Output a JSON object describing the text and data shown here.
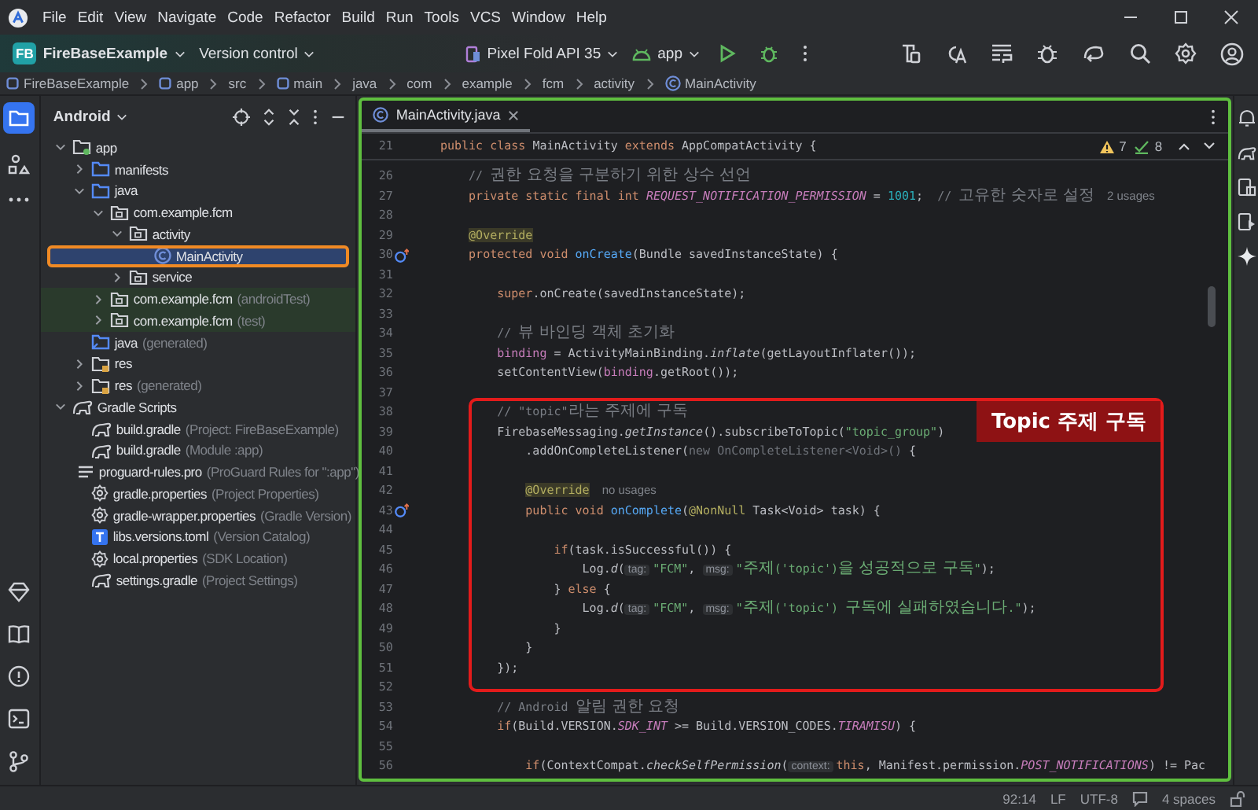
{
  "menu": [
    "File",
    "Edit",
    "View",
    "Navigate",
    "Code",
    "Refactor",
    "Build",
    "Run",
    "Tools",
    "VCS",
    "Window",
    "Help"
  ],
  "toolbar": {
    "project_badge": "FB",
    "project": "FireBaseExample",
    "vcs": "Version control",
    "device": "Pixel Fold API 35",
    "run_config": "app"
  },
  "breadcrumbs": [
    {
      "label": "FireBaseExample",
      "kind": "module"
    },
    {
      "label": "app",
      "kind": "module"
    },
    {
      "label": "src",
      "kind": "dir"
    },
    {
      "label": "main",
      "kind": "module"
    },
    {
      "label": "java",
      "kind": "dir"
    },
    {
      "label": "com",
      "kind": "dir"
    },
    {
      "label": "example",
      "kind": "dir"
    },
    {
      "label": "fcm",
      "kind": "dir"
    },
    {
      "label": "activity",
      "kind": "dir"
    },
    {
      "label": "MainActivity",
      "kind": "class"
    }
  ],
  "project": {
    "view": "Android",
    "tree": [
      {
        "label": "app",
        "kind": "module",
        "expanded": true,
        "selected": false,
        "children": [
          {
            "label": "manifests",
            "kind": "src_folder",
            "expanded": false,
            "selected": false
          },
          {
            "label": "java",
            "kind": "src_folder",
            "expanded": true,
            "selected": false,
            "children": [
              {
                "label": "com.example.fcm",
                "kind": "package",
                "expanded": true,
                "selected": false,
                "children": [
                  {
                    "label": "activity",
                    "kind": "package",
                    "expanded": true,
                    "selected": false,
                    "children": [
                      {
                        "label": "MainActivity",
                        "kind": "class",
                        "selected": true,
                        "highlighted": true
                      }
                    ]
                  },
                  {
                    "label": "service",
                    "kind": "package",
                    "expanded": false,
                    "selected": false
                  }
                ]
              },
              {
                "label": "com.example.fcm",
                "hint": "(androidTest)",
                "kind": "test_package",
                "expanded": false,
                "selected": false
              },
              {
                "label": "com.example.fcm",
                "hint": "(test)",
                "kind": "test_package",
                "expanded": false,
                "selected": false
              }
            ]
          },
          {
            "label": "java",
            "hint": "(generated)",
            "kind": "gen_folder",
            "selected": false
          },
          {
            "label": "res",
            "kind": "res_folder",
            "expanded": false,
            "selected": false
          },
          {
            "label": "res",
            "hint": "(generated)",
            "kind": "res_folder",
            "expanded": false,
            "selected": false
          }
        ]
      },
      {
        "label": "Gradle Scripts",
        "kind": "gradle",
        "expanded": true,
        "selected": false,
        "children": [
          {
            "label": "build.gradle",
            "hint": "(Project: FireBaseExample)",
            "kind": "gradle",
            "selected": false
          },
          {
            "label": "build.gradle",
            "hint": "(Module :app)",
            "kind": "gradle",
            "selected": false
          },
          {
            "label": "proguard-rules.pro",
            "hint": "(ProGuard Rules for \":app\")",
            "kind": "proguard",
            "selected": false
          },
          {
            "label": "gradle.properties",
            "hint": "(Project Properties)",
            "kind": "properties",
            "selected": false
          },
          {
            "label": "gradle-wrapper.properties",
            "hint": "(Gradle Version)",
            "kind": "properties",
            "selected": false
          },
          {
            "label": "libs.versions.toml",
            "hint": "(Version Catalog)",
            "kind": "toml",
            "selected": false
          },
          {
            "label": "local.properties",
            "hint": "(SDK Location)",
            "kind": "properties",
            "selected": false
          },
          {
            "label": "settings.gradle",
            "hint": "(Project Settings)",
            "kind": "gradle",
            "selected": false
          }
        ]
      }
    ]
  },
  "editor": {
    "tab": "MainActivity.java",
    "warnings": "7",
    "checks": "8",
    "sticky": {
      "number": "21",
      "tokens": [
        {
          "kind": "kw",
          "text": "    public class "
        },
        {
          "kind": "txt",
          "text": "MainActivity "
        },
        {
          "kind": "kw",
          "text": "extends "
        },
        {
          "kind": "txt",
          "text": "AppCompatActivity {"
        }
      ]
    },
    "lines_before": [
      {
        "number": "26",
        "tokens": [
          {
            "kind": "com",
            "text": "        // "
          },
          {
            "kind": "com_ko",
            "text": "권한 요청을 구분하기 위한 상수 선언"
          }
        ]
      },
      {
        "number": "27",
        "tokens": [
          {
            "kind": "kw",
            "text": "        private static final int "
          },
          {
            "kind": "sfield",
            "text": "REQUEST_NOTIFICATION_PERMISSION"
          },
          {
            "kind": "txt",
            "text": " = "
          },
          {
            "kind": "num",
            "text": "1001"
          },
          {
            "kind": "txt",
            "text": ";  "
          },
          {
            "kind": "com",
            "text": "// "
          },
          {
            "kind": "com_ko",
            "text": "고유한 숫자로 설정"
          },
          {
            "kind": "hint",
            "text": "2 usages"
          }
        ]
      },
      {
        "number": "28"
      },
      {
        "number": "29",
        "tokens": [
          {
            "kind": "ann_marked",
            "text": "        @Override"
          }
        ]
      },
      {
        "number": "30",
        "override_marker": true,
        "tokens": [
          {
            "kind": "kw",
            "text": "        protected void "
          },
          {
            "kind": "decl",
            "text": "onCreate"
          },
          {
            "kind": "txt",
            "text": "(Bundle savedInstanceState) {"
          }
        ]
      },
      {
        "number": "31"
      },
      {
        "number": "32",
        "tokens": [
          {
            "kind": "kw",
            "text": "            super"
          },
          {
            "kind": "txt",
            "text": ".onCreate(savedInstanceState);"
          }
        ]
      },
      {
        "number": "33"
      },
      {
        "number": "34",
        "tokens": [
          {
            "kind": "com",
            "text": "            // "
          },
          {
            "kind": "com_ko",
            "text": "뷰 바인딩 객체 초기화"
          }
        ]
      },
      {
        "number": "35",
        "tokens": [
          {
            "kind": "field",
            "text": "            binding"
          },
          {
            "kind": "txt",
            "text": " = ActivityMainBinding."
          },
          {
            "kind": "ital",
            "text": "inflate"
          },
          {
            "kind": "txt",
            "text": "(getLayoutInflater());"
          }
        ]
      },
      {
        "number": "36",
        "tokens": [
          {
            "kind": "txt",
            "text": "            setContentView("
          },
          {
            "kind": "field",
            "text": "binding"
          },
          {
            "kind": "txt",
            "text": ".getRoot());"
          }
        ]
      },
      {
        "number": "37"
      }
    ],
    "callout": {
      "label": "Topic 주제 구독",
      "lines": [
        {
          "number": "38",
          "tokens": [
            {
              "kind": "com",
              "text": "            // \"topic\""
            },
            {
              "kind": "com_ko",
              "text": "라는 주제에 구독"
            }
          ]
        },
        {
          "number": "39",
          "tokens": [
            {
              "kind": "txt",
              "text": "            FirebaseMessaging."
            },
            {
              "kind": "ital",
              "text": "getInstance"
            },
            {
              "kind": "txt",
              "text": "().subscribeToTopic("
            },
            {
              "kind": "str",
              "text": "\"topic_group\""
            },
            {
              "kind": "txt",
              "text": ")"
            }
          ]
        },
        {
          "number": "40",
          "tokens": [
            {
              "kind": "txt",
              "text": "                .addOnCompleteListener("
            },
            {
              "kind": "dim",
              "text": "new OnCompleteListener<Void>()"
            },
            {
              "kind": "txt",
              "text": " {"
            }
          ]
        },
        {
          "number": "41"
        },
        {
          "number": "42",
          "tokens": [
            {
              "kind": "ann_marked",
              "text": "                @Override"
            },
            {
              "kind": "hint",
              "text": "no usages"
            }
          ]
        },
        {
          "number": "43",
          "override_marker": true,
          "tokens": [
            {
              "kind": "kw",
              "text": "                public void "
            },
            {
              "kind": "decl",
              "text": "onComplete"
            },
            {
              "kind": "txt",
              "text": "("
            },
            {
              "kind": "ann",
              "text": "@NonNull"
            },
            {
              "kind": "txt",
              "text": " Task<Void> task) {"
            }
          ]
        },
        {
          "number": "44"
        },
        {
          "number": "45",
          "tokens": [
            {
              "kind": "kw",
              "text": "                    if"
            },
            {
              "kind": "txt",
              "text": "(task.isSuccessful()) {"
            }
          ]
        },
        {
          "number": "46",
          "tokens": [
            {
              "kind": "txt",
              "text": "                        Log."
            },
            {
              "kind": "ital",
              "text": "d"
            },
            {
              "kind": "txt",
              "text": "("
            },
            {
              "kind": "param",
              "text": "tag:"
            },
            {
              "kind": "str",
              "text": "\"FCM\""
            },
            {
              "kind": "txt",
              "text": ", "
            },
            {
              "kind": "param",
              "text": "msg:"
            },
            {
              "kind": "str",
              "text": "\""
            },
            {
              "kind": "str_ko",
              "text": "주제"
            },
            {
              "kind": "str",
              "text": "('topic')"
            },
            {
              "kind": "str_ko",
              "text": "을 성공적으로 구독"
            },
            {
              "kind": "str",
              "text": "\""
            },
            {
              "kind": "txt",
              "text": ");"
            }
          ]
        },
        {
          "number": "47",
          "tokens": [
            {
              "kind": "txt",
              "text": "                    } "
            },
            {
              "kind": "kw",
              "text": "else"
            },
            {
              "kind": "txt",
              "text": " {"
            }
          ]
        },
        {
          "number": "48",
          "tokens": [
            {
              "kind": "txt",
              "text": "                        Log."
            },
            {
              "kind": "ital",
              "text": "d"
            },
            {
              "kind": "txt",
              "text": "("
            },
            {
              "kind": "param",
              "text": "tag:"
            },
            {
              "kind": "str",
              "text": "\"FCM\""
            },
            {
              "kind": "txt",
              "text": ", "
            },
            {
              "kind": "param",
              "text": "msg:"
            },
            {
              "kind": "str",
              "text": "\""
            },
            {
              "kind": "str_ko",
              "text": "주제"
            },
            {
              "kind": "str",
              "text": "('topic') "
            },
            {
              "kind": "str_ko",
              "text": "구독에 실패하였습니다"
            },
            {
              "kind": "str",
              "text": ".\""
            },
            {
              "kind": "txt",
              "text": ");"
            }
          ]
        },
        {
          "number": "49",
          "tokens": [
            {
              "kind": "txt",
              "text": "                    }"
            }
          ]
        },
        {
          "number": "50",
          "tokens": [
            {
              "kind": "txt",
              "text": "                }"
            }
          ]
        },
        {
          "number": "51",
          "tokens": [
            {
              "kind": "txt",
              "text": "            });"
            }
          ]
        }
      ]
    },
    "lines_after": [
      {
        "number": "52"
      },
      {
        "number": "53",
        "tokens": [
          {
            "kind": "com",
            "text": "            // Android "
          },
          {
            "kind": "com_ko",
            "text": "알림 권한 요청"
          }
        ]
      },
      {
        "number": "54",
        "tokens": [
          {
            "kind": "kw",
            "text": "            if"
          },
          {
            "kind": "txt",
            "text": "(Build.VERSION."
          },
          {
            "kind": "sfield",
            "text": "SDK_INT"
          },
          {
            "kind": "txt",
            "text": " >= Build.VERSION_CODES."
          },
          {
            "kind": "sfield",
            "text": "TIRAMISU"
          },
          {
            "kind": "txt",
            "text": ") {"
          }
        ]
      },
      {
        "number": "55"
      },
      {
        "number": "56",
        "tokens": [
          {
            "kind": "kw",
            "text": "                if"
          },
          {
            "kind": "txt",
            "text": "(ContextCompat."
          },
          {
            "kind": "ital",
            "text": "checkSelfPermission"
          },
          {
            "kind": "txt",
            "text": "("
          },
          {
            "kind": "param",
            "text": "context:"
          },
          {
            "kind": "kw",
            "text": "this"
          },
          {
            "kind": "txt",
            "text": ", Manifest.permission."
          },
          {
            "kind": "sfield",
            "text": "POST_NOTIFICATIONS"
          },
          {
            "kind": "txt",
            "text": ") != Pac"
          }
        ]
      }
    ]
  },
  "status": {
    "position": "92:14",
    "line_separator": "LF",
    "encoding": "UTF-8",
    "indent": "4 spaces"
  }
}
